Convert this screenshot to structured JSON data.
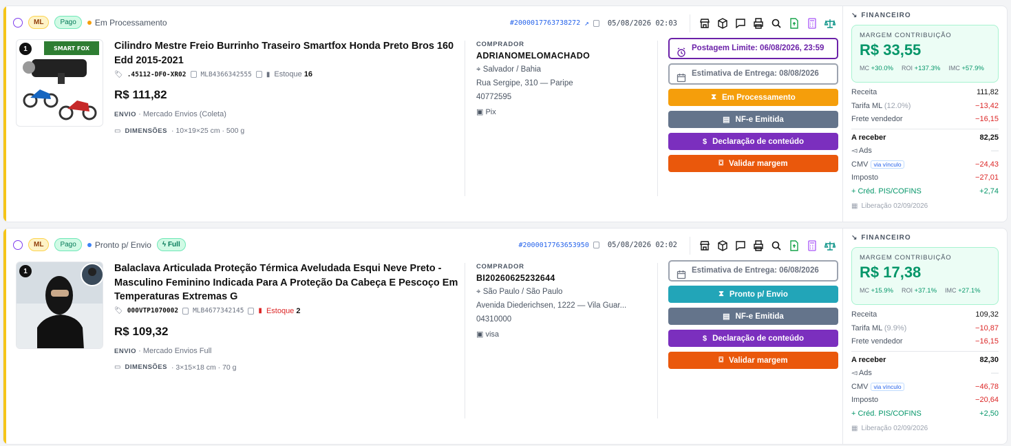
{
  "orders": [
    {
      "channel_badge": "ML",
      "payment_badge": "Pago",
      "status_text": "Em Processamento",
      "status_color": "#f59e0b",
      "order_id": "#2000017763738272",
      "order_date": "05/08/2026 02:03",
      "quantity": "1",
      "title": "Cilindro Mestre Freio Burrinho Traseiro Smartfox Honda Preto Bros 160 Edd 2015-2021",
      "sku": ".45112-DF0-XR02",
      "mlb": "MLB4366342555",
      "stock_label": "Estoque",
      "stock_value": "16",
      "price": "R$ 111,82",
      "shipping_label": "ENVIO",
      "shipping_value": "· Mercado Envios (Coleta)",
      "dims_label": "DIMENSÕES",
      "dims_value": "· 10×19×25 cm · 500 g",
      "buyer_label": "COMPRADOR",
      "buyer_name": "ADRIANOMELOMACHADO",
      "buyer_city": "Salvador / Bahia",
      "buyer_address": "Rua Sergipe, 310 — Paripe",
      "buyer_zip": "40772595",
      "payment_method": "Pix",
      "deadline_text": "Postagem Limite: 06/08/2026, 23:59",
      "estimate_text": "Estimativa de Entrega: 08/08/2026",
      "btn_status": "Em Processamento",
      "btn_nfe": "NF-e Emitida",
      "btn_decl": "Declaração de conteúdo",
      "btn_margin": "Validar margem",
      "fin": {
        "title": "FINANCEIRO",
        "margin_label": "MARGEM CONTRIBUIÇÃO",
        "margin_value": "R$ 33,55",
        "mc_label": "MC",
        "mc_value": "+30.0%",
        "roi_label": "ROI",
        "roi_value": "+137.3%",
        "imc_label": "IMC",
        "imc_value": "+57.9%",
        "receita_label": "Receita",
        "receita_value": "111,82",
        "tarifa_label": "Tarifa ML",
        "tarifa_pct": "(12.0%)",
        "tarifa_value": "−13,42",
        "frete_label": "Frete vendedor",
        "frete_value": "−16,15",
        "receber_label": "A receber",
        "receber_value": "82,25",
        "ads_label": "Ads",
        "ads_value": "—",
        "cmv_label": "CMV",
        "cmv_tag": "via vínculo",
        "cmv_value": "−24,43",
        "imposto_label": "Imposto",
        "imposto_value": "−27,01",
        "pis_label": "+ Créd. PIS/COFINS",
        "pis_value": "+2,74",
        "liberacao": "Liberação 02/09/2026"
      }
    },
    {
      "channel_badge": "ML",
      "payment_badge": "Pago",
      "status_text": "Pronto p/ Envio",
      "status_color": "#3b82f6",
      "full_badge": "Full",
      "order_id": "#2000017763653950",
      "order_date": "05/08/2026 02:02",
      "quantity": "1",
      "title": "Balaclava Articulada Proteção Térmica Aveludada Esqui Neve Preto - Masculino Feminino Indicada Para A Proteção Da Cabeça E Pescoço Em Temperaturas Extremas G",
      "sku": "000VTP1070002",
      "mlb": "MLB4677342145",
      "stock_label": "Estoque",
      "stock_value": "2",
      "price": "R$ 109,32",
      "shipping_label": "ENVIO",
      "shipping_value": "· Mercado Envios Full",
      "dims_label": "DIMENSÕES",
      "dims_value": "· 3×15×18 cm · 70 g",
      "buyer_label": "COMPRADOR",
      "buyer_name": "BI20260625232644",
      "buyer_city": "São Paulo / São Paulo",
      "buyer_address": "Avenida Diederichsen, 1222 — Vila Guar...",
      "buyer_zip": "04310000",
      "payment_method": "visa",
      "estimate_text": "Estimativa de Entrega: 06/08/2026",
      "btn_status": "Pronto p/ Envio",
      "btn_nfe": "NF-e Emitida",
      "btn_decl": "Declaração de conteúdo",
      "btn_margin": "Validar margem",
      "fin": {
        "title": "FINANCEIRO",
        "margin_label": "MARGEM CONTRIBUIÇÃO",
        "margin_value": "R$ 17,38",
        "mc_label": "MC",
        "mc_value": "+15.9%",
        "roi_label": "ROI",
        "roi_value": "+37.1%",
        "imc_label": "IMC",
        "imc_value": "+27.1%",
        "receita_label": "Receita",
        "receita_value": "109,32",
        "tarifa_label": "Tarifa ML",
        "tarifa_pct": "(9.9%)",
        "tarifa_value": "−10,87",
        "frete_label": "Frete vendedor",
        "frete_value": "−16,15",
        "receber_label": "A receber",
        "receber_value": "82,30",
        "ads_label": "Ads",
        "ads_value": "—",
        "cmv_label": "CMV",
        "cmv_tag": "via vínculo",
        "cmv_value": "−46,78",
        "imposto_label": "Imposto",
        "imposto_value": "−20,64",
        "pis_label": "+ Créd. PIS/COFINS",
        "pis_value": "+2,50",
        "liberacao": "Liberação 02/09/2026"
      }
    }
  ],
  "toolbar_icons": [
    "store-icon",
    "box-icon",
    "chat-icon",
    "printer-icon",
    "search-icon",
    "invoice-icon",
    "calculator-icon",
    "scale-icon"
  ]
}
